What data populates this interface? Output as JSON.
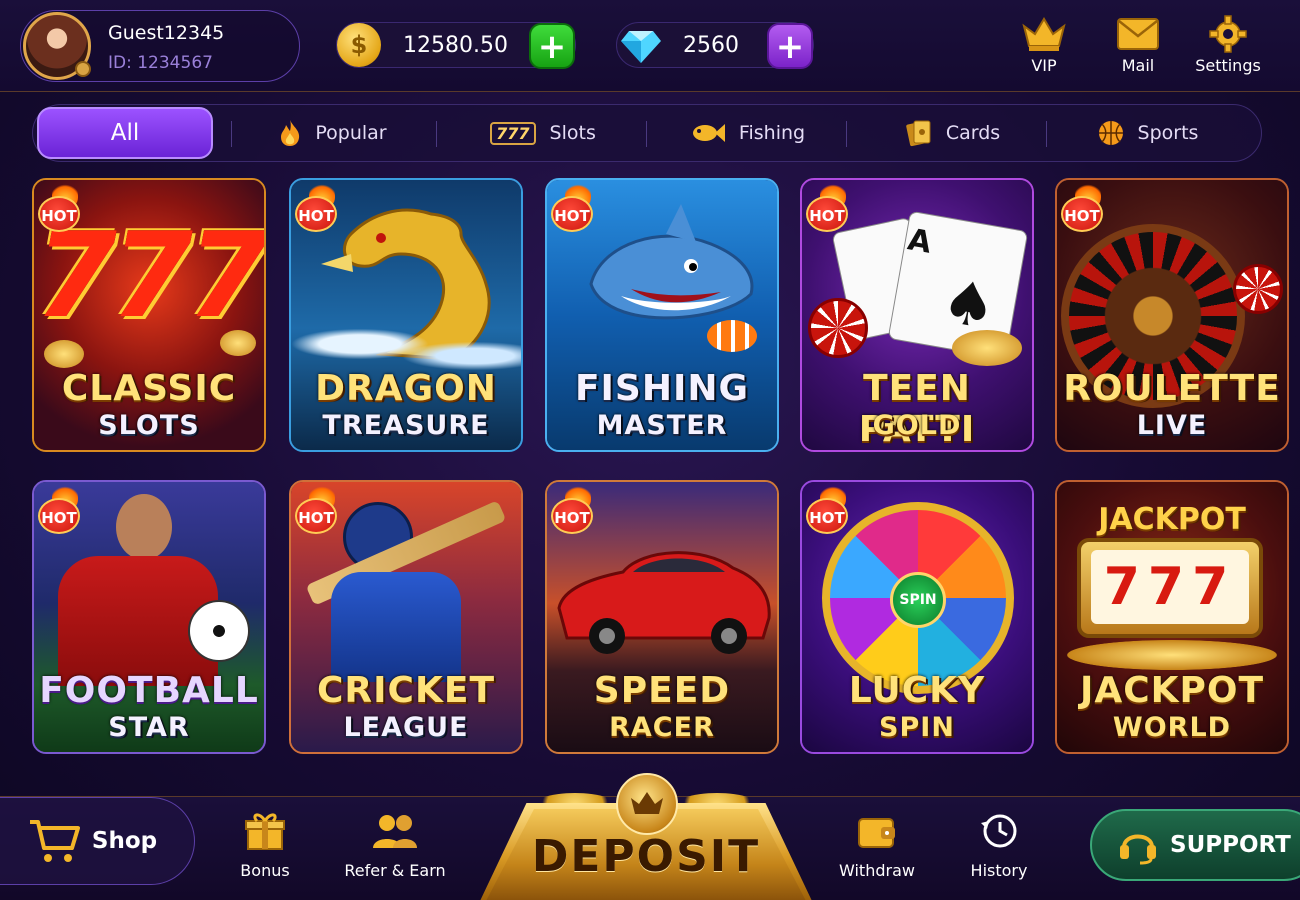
{
  "profile": {
    "username": "Guest12345",
    "user_id": "ID: 1234567"
  },
  "wallet": {
    "coins": "12580.50",
    "coin_symbol": "$",
    "gems": "2560",
    "plus": "+"
  },
  "top_actions": {
    "vip": "VIP",
    "mail": "Mail",
    "settings": "Settings"
  },
  "tabs": [
    {
      "label": "All",
      "icon": "all"
    },
    {
      "label": "Popular",
      "icon": "flame-icon"
    },
    {
      "label": "Slots",
      "icon": "slots-777-icon",
      "icon_text": "777"
    },
    {
      "label": "Fishing",
      "icon": "fish-icon"
    },
    {
      "label": "Cards",
      "icon": "cards-icon"
    },
    {
      "label": "Sports",
      "icon": "basketball-icon"
    }
  ],
  "hot_label": "HOT",
  "games": [
    {
      "line1": "CLASSIC",
      "line2": "SLOTS",
      "hot": true,
      "art_text": "777"
    },
    {
      "line1": "DRAGON",
      "line2": "TREASURE",
      "hot": true
    },
    {
      "line1": "FISHING",
      "line2": "MASTER",
      "hot": true
    },
    {
      "line1": "TEEN PATTI",
      "line2": "GOLD",
      "hot": true,
      "art_text": "A"
    },
    {
      "line1": "ROULETTE",
      "line2": "LIVE",
      "hot": true
    },
    {
      "line1": "FOOTBALL",
      "line2": "STAR",
      "hot": true
    },
    {
      "line1": "CRICKET",
      "line2": "LEAGUE",
      "hot": true
    },
    {
      "line1": "SPEED",
      "line2": "RACER",
      "hot": true
    },
    {
      "line1": "LUCKY",
      "line2": "SPIN",
      "hot": true,
      "art_text": "SPIN"
    },
    {
      "line1": "JACKPOT",
      "line2": "WORLD",
      "hot": false,
      "art_text": "JACKPOT",
      "art_text2": "777"
    }
  ],
  "bottom_nav": {
    "shop": "Shop",
    "bonus": "Bonus",
    "refer": "Refer & Earn",
    "deposit": "DEPOSIT",
    "withdraw": "Withdraw",
    "history": "History",
    "support": "SUPPORT"
  },
  "colors": {
    "accent_purple": "#7b2fe0",
    "gold": "#ffd56a",
    "green": "#1fb51a",
    "background": "#170b34"
  }
}
